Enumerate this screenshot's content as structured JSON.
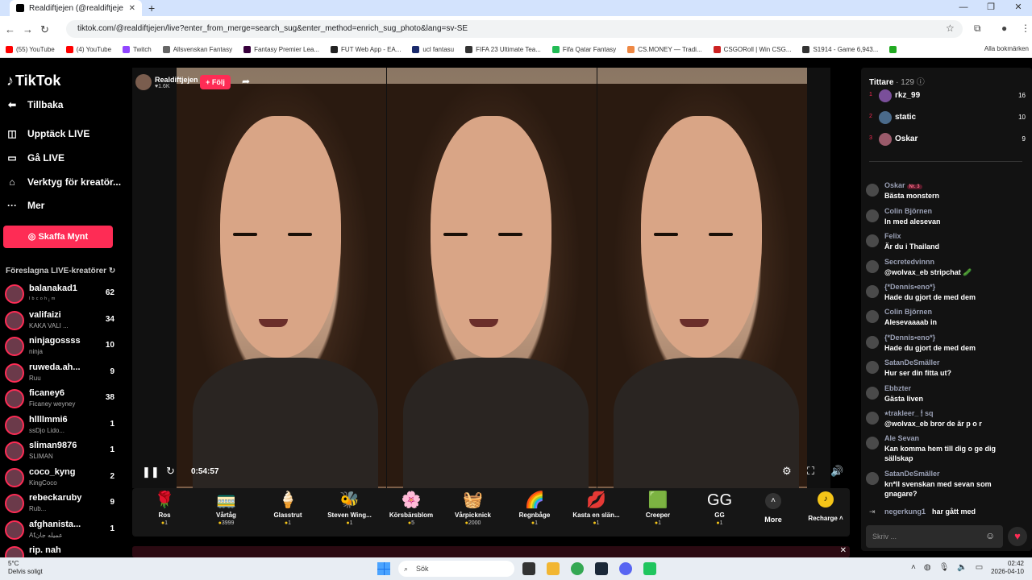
{
  "browser": {
    "tab_title": "Realdiftjejen (@realdiftjeje",
    "url": "tiktok.com/@realdiftjejen/live?enter_from_merge=search_sug&enter_method=enrich_sug_photo&lang=sv-SE",
    "bookmarks": [
      {
        "label": "(55) YouTube",
        "color": "#ff0000"
      },
      {
        "label": "(4) YouTube",
        "color": "#ff0000"
      },
      {
        "label": "Twitch",
        "color": "#9146ff"
      },
      {
        "label": "Allsvenskan Fantasy",
        "color": "#666"
      },
      {
        "label": "Fantasy Premier Lea...",
        "color": "#37003c"
      },
      {
        "label": "FUT Web App - EA...",
        "color": "#222"
      },
      {
        "label": "ucl fantasu",
        "color": "#1a2a6c"
      },
      {
        "label": "FIFA 23 Ultimate Tea...",
        "color": "#333"
      },
      {
        "label": "Fifa Qatar Fantasy",
        "color": "#2b5"
      },
      {
        "label": "CS.MONEY — Tradi...",
        "color": "#e84"
      },
      {
        "label": "CSGORoll | Win CSG...",
        "color": "#c22"
      },
      {
        "label": "S1914 - Game 6,943...",
        "color": "#333"
      },
      {
        "label": "",
        "color": "#2a2"
      }
    ],
    "all_bookmarks": "Alla bokmärken"
  },
  "sidebar": {
    "logo": "TikTok",
    "back": "Tillbaka",
    "nav": [
      {
        "label": "Upptäck LIVE",
        "icon": "◫"
      },
      {
        "label": "Gå LIVE",
        "icon": "▭"
      },
      {
        "label": "Verktyg för kreatör...",
        "icon": "⌂"
      },
      {
        "label": "Mer",
        "icon": "···"
      }
    ],
    "coins_button": "Skaffa Mynt",
    "suggested_header": "Föreslagna LIVE-kreatörer",
    "creators": [
      {
        "name": "balanakad1",
        "sub": "ˡ ᵇ ᶜ ᵒ ʰ ᵢ ᵐ",
        "count": "62"
      },
      {
        "name": "valifaizi",
        "sub": "KAKA VALI ...",
        "count": "34"
      },
      {
        "name": "ninjagossss",
        "sub": "ninja",
        "count": "10"
      },
      {
        "name": "ruweda.ah...",
        "sub": "Ruu",
        "count": "9"
      },
      {
        "name": "ficaney6",
        "sub": "Ficaney weyney",
        "count": "38"
      },
      {
        "name": "hllllmmi6",
        "sub": "ssDjo Lido...",
        "count": "1"
      },
      {
        "name": "sliman9876",
        "sub": "SLIMAN",
        "count": "1"
      },
      {
        "name": "coco_kyng",
        "sub": "KingCoco",
        "count": "2"
      },
      {
        "name": "rebeckaruby",
        "sub": "Rub...",
        "count": "9"
      },
      {
        "name": "afghanista...",
        "sub": "Afعمیله جان",
        "count": "1"
      },
      {
        "name": "rip. nah",
        "sub": "",
        "count": ""
      }
    ]
  },
  "stream": {
    "host_name": "Realdiftjejen",
    "host_viewers": "1.6K",
    "follow": "+ Följ",
    "time": "0:54:57"
  },
  "gifts": [
    {
      "name": "Ros",
      "price": "1",
      "icon": "🌹"
    },
    {
      "name": "Vårtåg",
      "price": "3999",
      "icon": "🚃"
    },
    {
      "name": "Glasstrut",
      "price": "1",
      "icon": "🍦"
    },
    {
      "name": "Steven Wing...",
      "price": "1",
      "icon": "🐝"
    },
    {
      "name": "Körsbärsblom",
      "price": "5",
      "icon": "🌸"
    },
    {
      "name": "Vårpicknick",
      "price": "2000",
      "icon": "🧺"
    },
    {
      "name": "Regnbåge",
      "price": "1",
      "icon": "🌈"
    },
    {
      "name": "Kasta en slän...",
      "price": "1",
      "icon": "💋"
    },
    {
      "name": "Creeper",
      "price": "1",
      "icon": "🟩"
    },
    {
      "name": "GG",
      "price": "1",
      "icon": "GG"
    }
  ],
  "gift_more": "More",
  "recharge": "Recharge",
  "chat": {
    "viewers_label": "Tittare",
    "viewers_count": "129",
    "top_viewers": [
      {
        "rank": "1",
        "name": "rkz_99",
        "score": "16"
      },
      {
        "rank": "2",
        "name": "static",
        "score": "10"
      },
      {
        "rank": "3",
        "name": "Oskar",
        "score": "9"
      }
    ],
    "messages": [
      {
        "user": "Oskar",
        "badge": "Nr. 3",
        "text": "Bästa monstern"
      },
      {
        "user": "Colin Björnen",
        "badge": "",
        "text": "In med alesevan"
      },
      {
        "user": "Felix",
        "badge": "",
        "text": "Är du i Thailand"
      },
      {
        "user": "Secretedvinnn",
        "badge": "",
        "text": "@wolvax_eb stripchat 🥒"
      },
      {
        "user": "{*Dennis•eno*}",
        "badge": "",
        "text": "Hade du gjort de med dem"
      },
      {
        "user": "Colin Björnen",
        "badge": "",
        "text": "Alesevaaaab in"
      },
      {
        "user": "{*Dennis•eno*}",
        "badge": "",
        "text": "Hade du gjort de med dem"
      },
      {
        "user": "SatanDeSmäller",
        "badge": "",
        "text": "Hur ser din fitta ut?"
      },
      {
        "user": "Ebbzter",
        "badge": "",
        "text": "Gästa liven"
      },
      {
        "user": "⭑trakleer_ 🕯 sq",
        "badge": "",
        "text": "@wolvax_eb bror de är p o r"
      },
      {
        "user": "Ale Sevan",
        "badge": "",
        "text": "Kan komma hem till dig o ge dig sällskap"
      },
      {
        "user": "SatanDeSmäller",
        "badge": "",
        "text": "kn*ll svenskan med sevan som gnagare?"
      }
    ],
    "join_user": "negerkung1",
    "join_text": "har gått med",
    "input_placeholder": "Skriv ..."
  },
  "taskbar": {
    "temp": "5°C",
    "weather": "Delvis soligt",
    "search": "Sök",
    "time": "02:42",
    "date": "2026-04-10"
  }
}
